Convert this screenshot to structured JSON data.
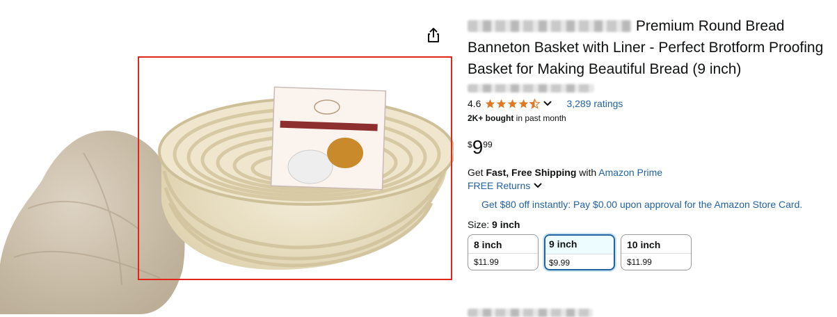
{
  "product": {
    "brand_blurred": "Saint Germain Bakery",
    "title": "Premium Round Bread Banneton Basket with Liner - Perfect Brotform Proofing Basket for Making Beautiful Bread (9 inch)",
    "store_link_blurred": "Visit the Saint Germain Bakery Store"
  },
  "rating": {
    "value": "4.6",
    "stars_filled": 4.5,
    "count_text": "3,289 ratings"
  },
  "bought": {
    "bold": "2K+ bought",
    "rest": " in past month"
  },
  "price": {
    "currency": "$",
    "whole": "9",
    "fraction": "99"
  },
  "shipping": {
    "prefix": "Get ",
    "bold": "Fast, Free Shipping",
    "mid": " with ",
    "link": "Amazon Prime"
  },
  "returns": {
    "label": "FREE Returns"
  },
  "promo": {
    "text": "Get $80 off instantly: Pay $0.00 upon approval for the Amazon Store Card."
  },
  "size": {
    "label": "Size: ",
    "selected": "9 inch",
    "options": [
      {
        "name": "8 inch",
        "price": "$11.99"
      },
      {
        "name": "9 inch",
        "price": "$9.99"
      },
      {
        "name": "10 inch",
        "price": "$11.99"
      }
    ]
  },
  "colors": {
    "link": "#2162A1",
    "star": "#DE7921",
    "highlight": "#e3241a"
  },
  "icons": {
    "share": "share-icon",
    "star": "star-icon",
    "chevron": "chevron-down-icon"
  }
}
